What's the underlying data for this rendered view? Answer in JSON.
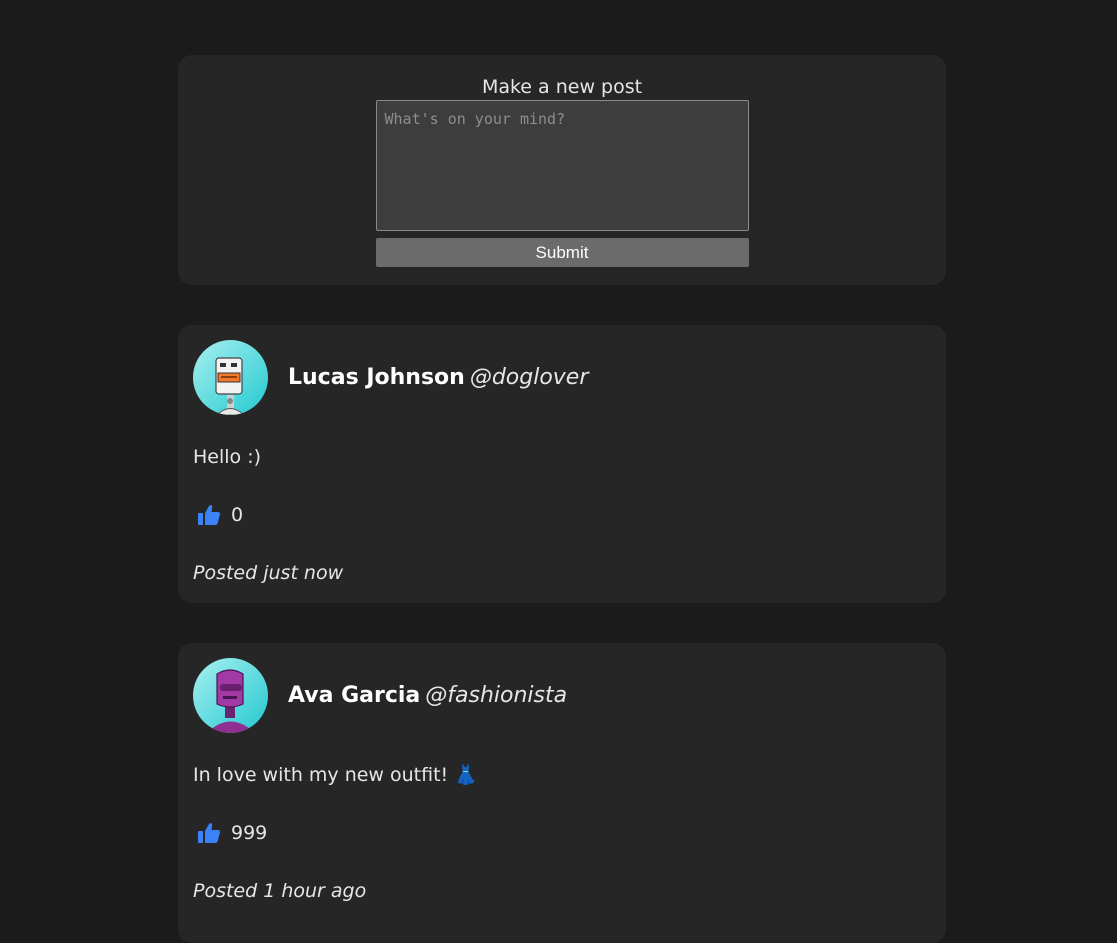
{
  "composer": {
    "title": "Make a new post",
    "placeholder": "What's on your mind?",
    "value": "",
    "submit_label": "Submit"
  },
  "posts": [
    {
      "author_name": "Lucas Johnson",
      "handle": "@doglover",
      "text": "Hello :)",
      "likes": "0",
      "posted": "Posted just now",
      "avatar_icon": "robot-avatar-white"
    },
    {
      "author_name": "Ava Garcia",
      "handle": "@fashionista",
      "text": "In love with my new outfit! 👗",
      "likes": "999",
      "posted": "Posted 1 hour ago",
      "avatar_icon": "robot-avatar-purple"
    }
  ],
  "colors": {
    "page_background": "#1b1b1b",
    "card_background": "#262626",
    "like_blue": "#3b82f6",
    "avatar_background": "#4fd8dc"
  }
}
